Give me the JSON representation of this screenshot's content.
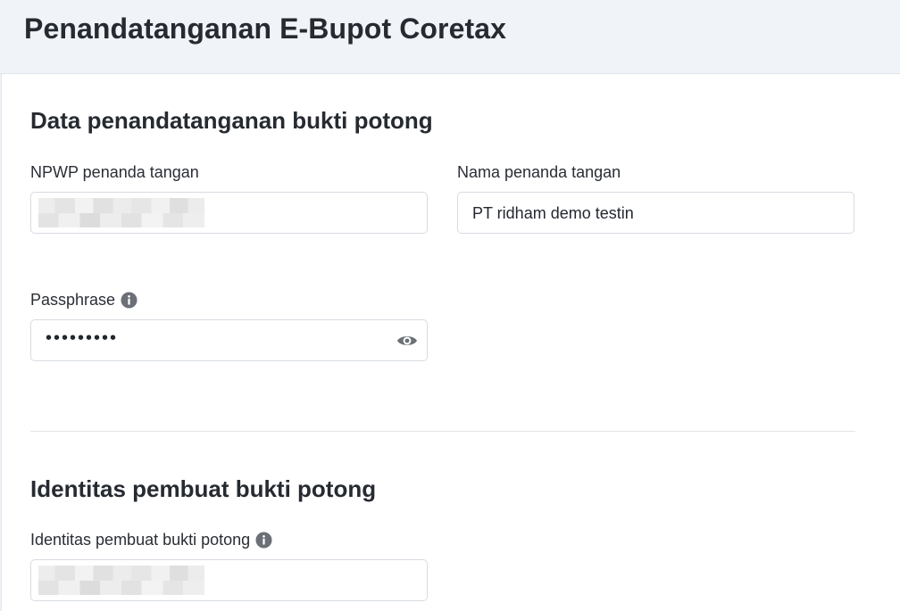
{
  "header": {
    "title": "Penandatanganan E-Bupot Coretax"
  },
  "signer_section": {
    "title": "Data penandatanganan bukti potong",
    "npwp": {
      "label": "NPWP penanda tangan",
      "value": ""
    },
    "name": {
      "label": "Nama penanda tangan",
      "value": "PT ridham demo testin"
    },
    "passphrase": {
      "label": "Passphrase",
      "masked_value": "•••••••••",
      "info_icon": "info-icon",
      "toggle_icon": "eye-icon"
    }
  },
  "creator_section": {
    "title": "Identitas pembuat bukti potong",
    "identity": {
      "label": "Identitas pembuat bukti potong",
      "value": "",
      "info_icon": "info-icon"
    }
  },
  "colors": {
    "header_bg": "#f0f3f8",
    "card_bg": "#ffffff",
    "border": "#d7dbe2",
    "icon": "#6b6f76"
  }
}
